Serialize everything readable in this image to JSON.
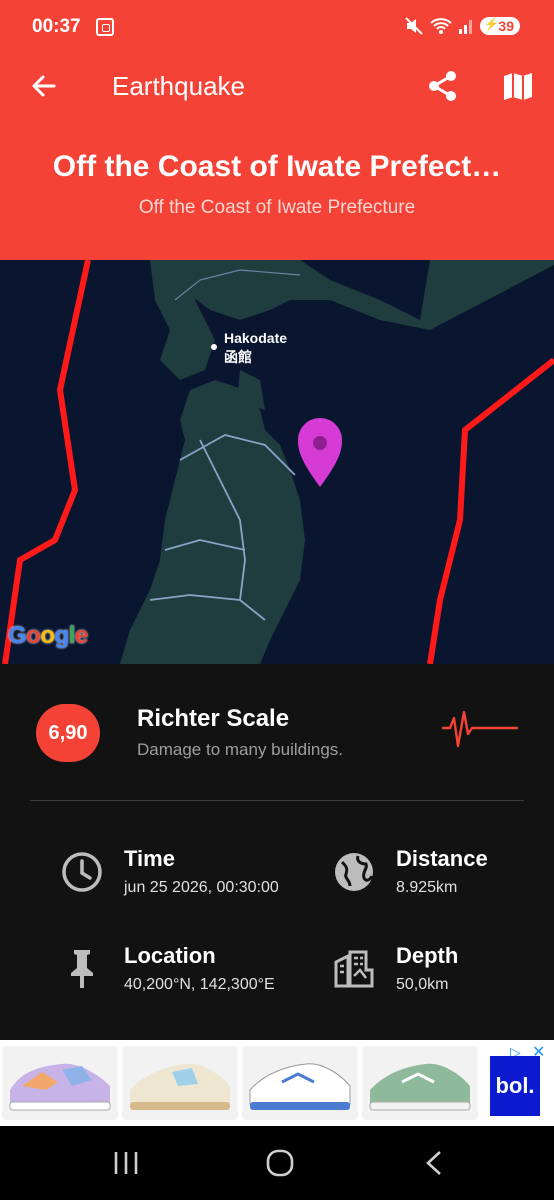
{
  "status": {
    "time": "00:37",
    "battery": "39"
  },
  "app_bar": {
    "title": "Earthquake"
  },
  "header": {
    "title": "Off the Coast of Iwate Prefect…",
    "subtitle": "Off the Coast of Iwate Prefecture"
  },
  "map": {
    "city_en": "Hakodate",
    "city_jp": "函館",
    "attribution": "Google"
  },
  "quake": {
    "magnitude": "6,90",
    "scale_title": "Richter Scale",
    "scale_desc": "Damage to many buildings."
  },
  "stats": {
    "time_label": "Time",
    "time_value": "jun 25 2026, 00:30:00",
    "distance_label": "Distance",
    "distance_value": "8.925km",
    "location_label": "Location",
    "location_value": "40,200°N, 142,300°E",
    "depth_label": "Depth",
    "depth_value": "50,0km"
  },
  "ad": {
    "brand": "bol."
  },
  "colors": {
    "accent": "#f44336",
    "pin": "#d63bd6",
    "background": "#121212"
  }
}
